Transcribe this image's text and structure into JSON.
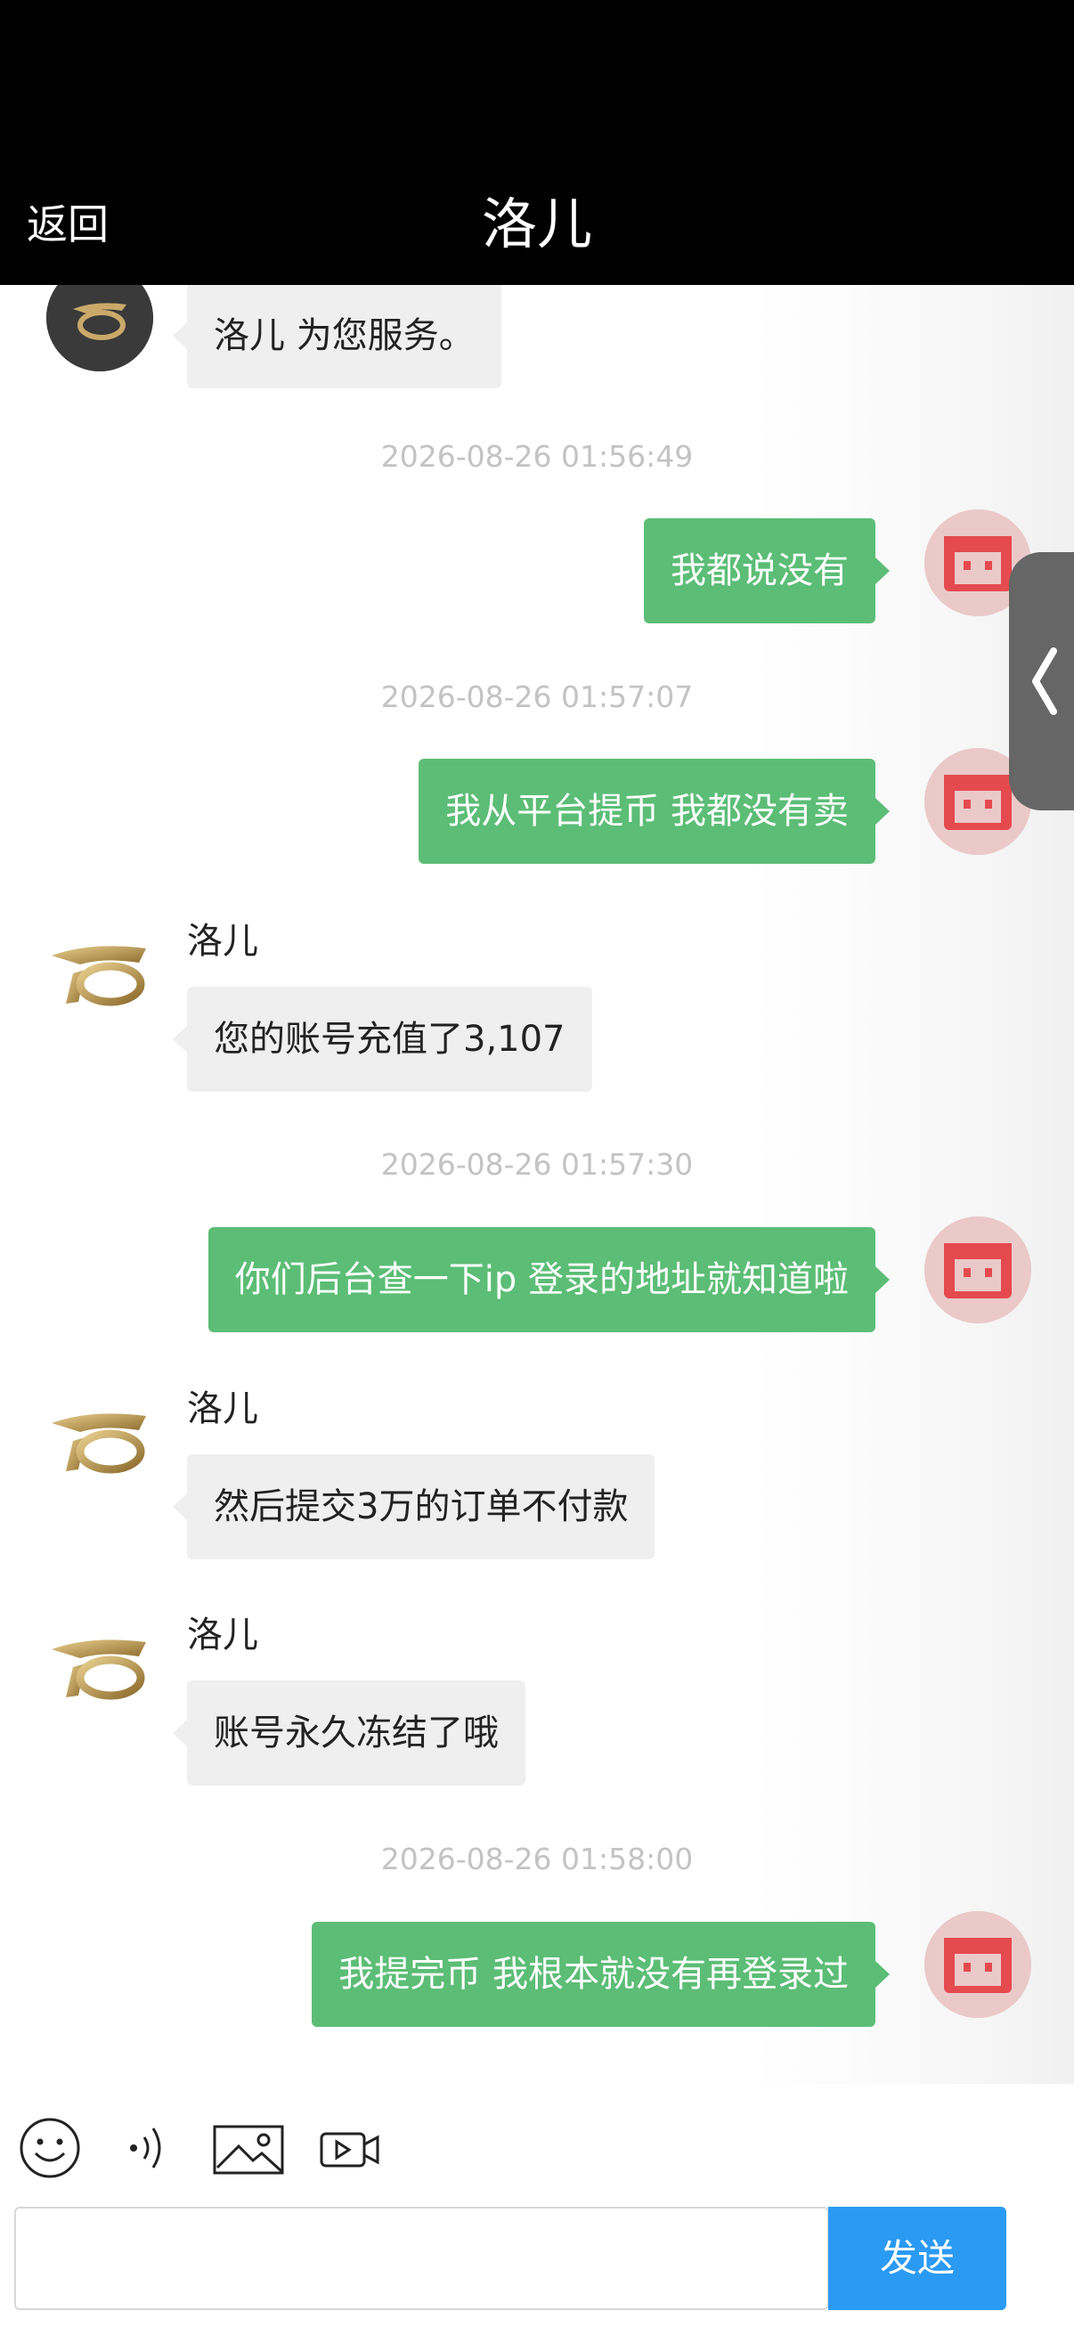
{
  "header": {
    "back_label": "返回",
    "title": "洛儿"
  },
  "messages": [
    {
      "type": "agent",
      "text": "洛儿 为您服务。"
    },
    {
      "type": "timestamp",
      "text": "2026-08-26 01:56:49"
    },
    {
      "type": "user",
      "text": "我都说没有"
    },
    {
      "type": "timestamp",
      "text": "2026-08-26 01:57:07"
    },
    {
      "type": "user",
      "text": "我从平台提币  我都没有卖"
    },
    {
      "type": "agent",
      "name": "洛儿",
      "text": "您的账号充值了3,107"
    },
    {
      "type": "timestamp",
      "text": "2026-08-26 01:57:30"
    },
    {
      "type": "user",
      "text": "你们后台查一下ip 登录的地址就知道啦"
    },
    {
      "type": "agent",
      "name": "洛儿",
      "text": "然后提交3万的订单不付款"
    },
    {
      "type": "agent",
      "name": "洛儿",
      "text": "账号永久冻结了哦"
    },
    {
      "type": "timestamp",
      "text": "2026-08-26 01:58:00"
    },
    {
      "type": "user",
      "text": "我提完币  我根本就没有再登录过"
    }
  ],
  "toolbar": {
    "icons": [
      "emoji-icon",
      "voice-icon",
      "image-icon",
      "video-icon"
    ]
  },
  "input": {
    "value": "",
    "placeholder": ""
  },
  "send_label": "发送",
  "colors": {
    "header": "#000000",
    "user_bubble": "#5cbd76",
    "agent_bubble": "#efefef",
    "send_button": "#2a9af3",
    "timestamp": "#c3c3c3"
  }
}
